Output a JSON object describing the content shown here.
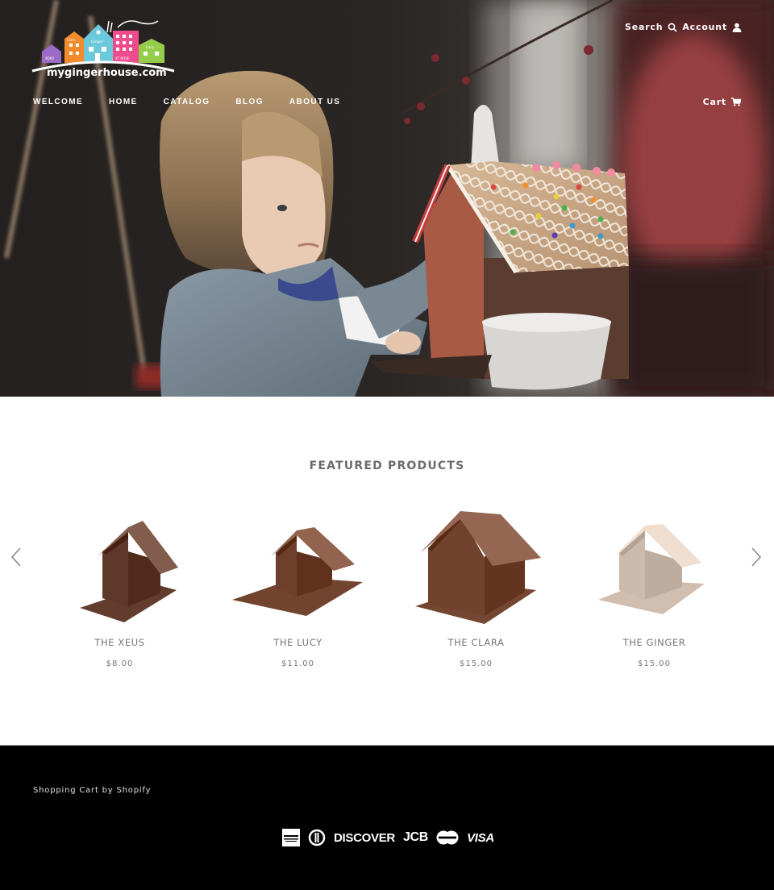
{
  "header": {
    "logo_text": "mygingerhouse.com",
    "logo_house_labels": [
      "XOXO",
      "Clara",
      "Ginger",
      "XT ROSE",
      "Lucy"
    ],
    "util_links": [
      {
        "label": "Search",
        "icon": "search-icon"
      },
      {
        "label": "Account",
        "icon": "user-icon"
      }
    ],
    "nav": [
      "WELCOME",
      "HOME",
      "CATALOG",
      "BLOG",
      "ABOUT US"
    ],
    "cart": {
      "label": "Cart",
      "icon": "cart-icon"
    }
  },
  "hero": {
    "description": "Child decorating a gingerbread house with icing and colorful candies"
  },
  "featured": {
    "title": "FEATURED PRODUCTS",
    "prev_icon": "chevron-left-icon",
    "next_icon": "chevron-right-icon",
    "products": [
      {
        "name": "THE XEUS",
        "price": "$8.00",
        "color": "#5a3526"
      },
      {
        "name": "THE LUCY",
        "price": "$11.00",
        "color": "#6a3b27"
      },
      {
        "name": "THE CLARA",
        "price": "$15.00",
        "color": "#6d3e2a"
      },
      {
        "name": "THE GINGER",
        "price": "$15.00",
        "color": "#c8b6a8"
      }
    ]
  },
  "footer": {
    "credit": "Shopping Cart by Shopify",
    "payment_methods": [
      "American Express",
      "Diners Club",
      "DISCOVER",
      "JCB",
      "MasterCard",
      "VISA"
    ]
  },
  "colors": {
    "accent_gray": "#767676",
    "footer_bg": "#000000",
    "logo_purple": "#9b6bc6",
    "logo_orange": "#f28a2e",
    "logo_cyan": "#6cc9dc",
    "logo_pink": "#ee4c8c",
    "logo_green": "#95cc4a"
  }
}
